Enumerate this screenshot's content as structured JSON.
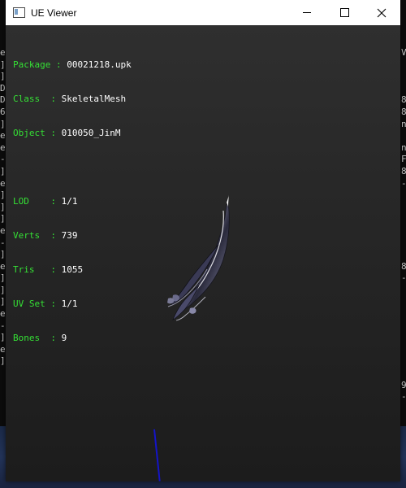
{
  "window": {
    "title": "UE Viewer"
  },
  "info": {
    "package": {
      "label": "Package",
      "value": "00021218.upk"
    },
    "class": {
      "label": "Class  ",
      "value": "SkeletalMesh"
    },
    "object": {
      "label": "Object ",
      "value": "010050_JinM"
    },
    "lod": {
      "label": "LOD    ",
      "value": "1/1"
    },
    "verts": {
      "label": "Verts  ",
      "value": "739"
    },
    "tris": {
      "label": "Tris   ",
      "value": "1055"
    },
    "uvset": {
      "label": "UV Set ",
      "value": "1/1"
    },
    "bones": {
      "label": "Bones  ",
      "value": "9"
    }
  },
  "colors": {
    "label_green": "#35e035",
    "value_white": "#ffffff",
    "axis_blue": "#1414c8"
  },
  "icons": {
    "app": "app-window-icon",
    "minimize": "minimize-icon",
    "maximize": "maximize-icon",
    "close": "close-icon"
  }
}
